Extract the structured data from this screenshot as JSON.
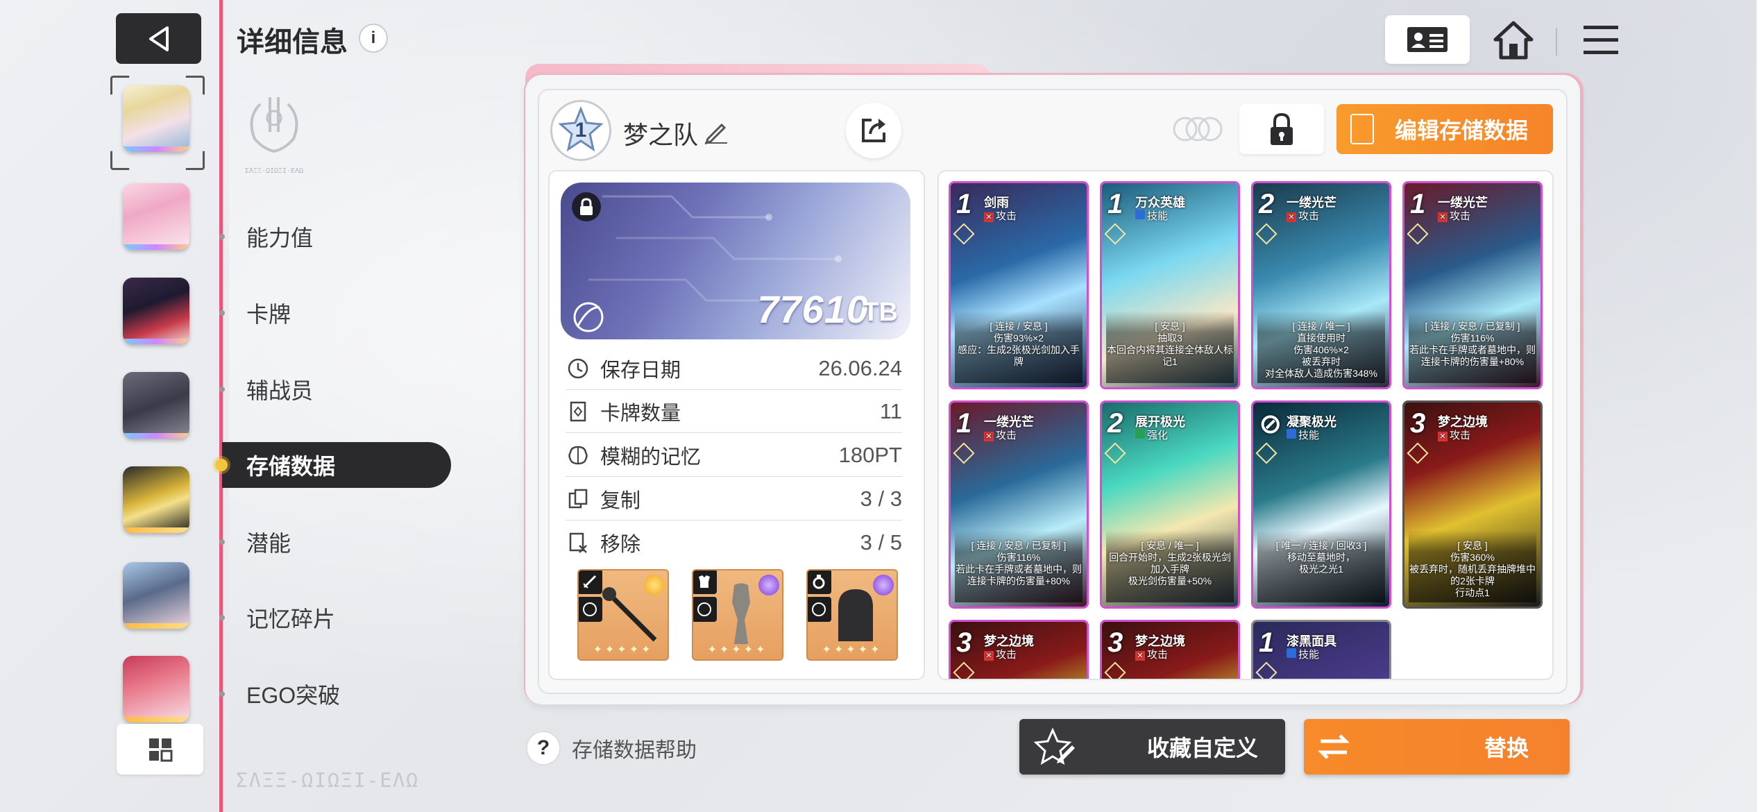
{
  "header": {
    "title": "详细信息",
    "info_icon": "i",
    "emblem_text": "ΣΛΞΞ-ΩΙΩΞΙ-ΕΛΩ"
  },
  "sidebar": {
    "menu": [
      {
        "label": "能力值"
      },
      {
        "label": "卡牌"
      },
      {
        "label": "辅战员"
      },
      {
        "label": "存储数据",
        "active": true
      },
      {
        "label": "潜能"
      },
      {
        "label": "记忆碎片"
      },
      {
        "label": "EGO突破"
      }
    ],
    "watermark": "ΣΛΞΞ-ΩΙΩΞΙ-ΕΛΩ"
  },
  "panel": {
    "team_level": "1",
    "team_name": "梦之队",
    "edit_save_label": "编辑存储数据",
    "tb_value": "77610",
    "tb_unit": "TB",
    "stats": [
      {
        "icon": "clock-icon",
        "label": "保存日期",
        "value": "26.06.24"
      },
      {
        "icon": "card-icon",
        "label": "卡牌数量",
        "value": "11"
      },
      {
        "icon": "brain-icon",
        "label": "模糊的记忆",
        "value": "180PT"
      },
      {
        "icon": "copy-icon",
        "label": "复制",
        "value": "3 / 3"
      },
      {
        "icon": "remove-icon",
        "label": "移除",
        "value": "3 / 5"
      }
    ],
    "relic_stars": "✦✦✦✦✦"
  },
  "cards": [
    {
      "cost": "1",
      "name": "剑雨",
      "type": "攻击",
      "type_kind": "x",
      "desc": "[ 连接 / 安息 ]\n伤害93%×2\n感应：生成2张极光剑加入手牌"
    },
    {
      "cost": "1",
      "name": "万众英雄",
      "type": "技能",
      "type_kind": "b",
      "desc": "[ 安息 ]\n抽取3\n本回合内将其连接全体敌人标记1"
    },
    {
      "cost": "2",
      "name": "一缕光芒",
      "type": "攻击",
      "type_kind": "x",
      "desc": "[ 连接 / 唯一 ]\n直接使用时\n伤害406%×2\n被丢弃时\n对全体敌人造成伤害348%"
    },
    {
      "cost": "1",
      "name": "一缕光芒",
      "type": "攻击",
      "type_kind": "x",
      "desc": "[ 连接 / 安息 / 已复制 ]\n伤害116%\n若此卡在手牌或者墓地中，则连接卡牌的伤害量+80%"
    },
    {
      "cost": "1",
      "name": "一缕光芒",
      "type": "攻击",
      "type_kind": "x",
      "desc": "[ 连接 / 安息 / 已复制 ]\n伤害116%\n若此卡在手牌或者墓地中，则连接卡牌的伤害量+80%"
    },
    {
      "cost": "2",
      "name": "展开极光",
      "type": "强化",
      "type_kind": "g",
      "desc": "[ 安息 / 唯一 ]\n回合开始时，生成2张极光剑加入手牌\n极光剑伤害量+50%"
    },
    {
      "cost": "⊘",
      "name": "凝聚极光",
      "type": "技能",
      "type_kind": "b",
      "desc": "[ 唯一 / 连接 / 回收3 ]\n移动至墓地时，\n极光之光1"
    },
    {
      "cost": "3",
      "name": "梦之边境",
      "type": "攻击",
      "type_kind": "x",
      "desc": "[ 安息 ]\n伤害360%\n被丢弃时，随机丢弃抽牌堆中的2张卡牌\n行动点1"
    },
    {
      "cost": "3",
      "name": "梦之边境",
      "type": "攻击",
      "type_kind": "x",
      "desc": ""
    },
    {
      "cost": "3",
      "name": "梦之边境",
      "type": "攻击",
      "type_kind": "x",
      "desc": ""
    },
    {
      "cost": "1",
      "name": "漆黑面具",
      "type": "技能",
      "type_kind": "b",
      "desc": ""
    }
  ],
  "footer": {
    "help_label": "存储数据帮助",
    "collect_label": "收藏自定义",
    "swap_label": "替换"
  },
  "colors": {
    "accent_pink": "#e8577a",
    "accent_orange": "#f6842a",
    "dark": "#2a2a2c"
  }
}
